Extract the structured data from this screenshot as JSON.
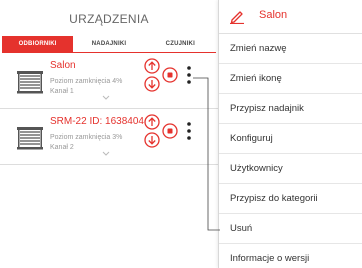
{
  "left": {
    "header_title": "URZĄDZENIA",
    "tabs": [
      "ODBIORNIKI",
      "NADAJNIKI",
      "CZUJNIKI"
    ],
    "devices": [
      {
        "name": "Salon",
        "status": "Poziom zamknięcia 4%",
        "channel": "Kanał 1"
      },
      {
        "name": "SRM-22 ID: 1638404",
        "status": "Poziom zamknięcia 3%",
        "channel": "Kanał 2"
      }
    ]
  },
  "menu": {
    "title": "Salon",
    "items": [
      "Zmień nazwę",
      "Zmień ikonę",
      "Przypisz nadajnik",
      "Konfiguruj",
      "Użytkownicy",
      "Przypisz do kategorii",
      "Usuń",
      "Informacje o wersji"
    ]
  },
  "colors": {
    "accent": "#e5322d",
    "text": "#333333",
    "muted": "#999999"
  },
  "icons": [
    "blind-icon",
    "arrow-up-icon",
    "arrow-down-icon",
    "stop-icon",
    "more-vertical-icon",
    "pencil-icon",
    "chevron-down-icon"
  ]
}
